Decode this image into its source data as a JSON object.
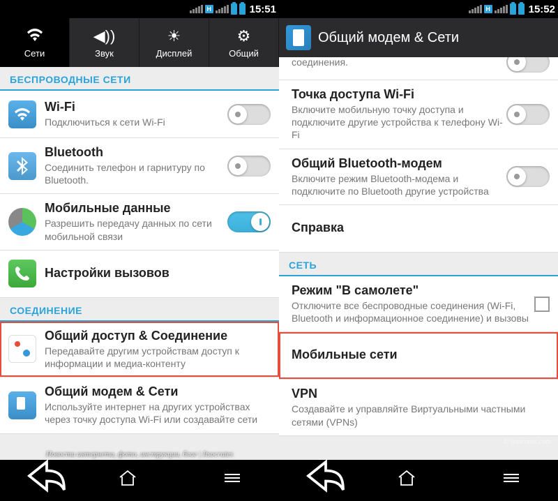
{
  "left": {
    "time": "15:51",
    "tabs": {
      "networks": "Сети",
      "sound": "Звук",
      "display": "Дисплей",
      "general": "Общий"
    },
    "sections": {
      "wireless": "БЕСПРОВОДНЫЕ СЕТИ",
      "connection": "СОЕДИНЕНИЕ"
    },
    "wifi": {
      "title": "Wi-Fi",
      "sub": "Подключиться к сети Wi-Fi"
    },
    "bluetooth": {
      "title": "Bluetooth",
      "sub": "Соединить телефон и гарнитуру по Bluetooth."
    },
    "mobiledata": {
      "title": "Мобильные данные",
      "sub": "Разрешить передачу данных по сети мобильной связи"
    },
    "calls": {
      "title": "Настройки вызовов"
    },
    "share": {
      "title": "Общий доступ & Соединение",
      "sub": "Передавайте другим устройствам доступ к информации и медиа-контенту"
    },
    "tether": {
      "title": "Общий модем & Сети",
      "sub": "Используйте интернет на других устройствах через точку доступа Wi-Fi или создавайте сети"
    }
  },
  "right": {
    "time": "15:52",
    "header": "Общий модем & Сети",
    "cut_sub": "соединения.",
    "hotspot": {
      "title": "Точка доступа Wi-Fi",
      "sub": "Включите мобильную точку доступа и подключите другие устройства к телефону Wi-Fi"
    },
    "btmodem": {
      "title": "Общий Bluetooth-модем",
      "sub": "Включите режим Bluetooth-модема и подключите по Bluetooth другие устройства"
    },
    "help": {
      "title": "Справка"
    },
    "section_net": "СЕТЬ",
    "airplane": {
      "title": "Режим \"В самолете\"",
      "sub": "Отключите все беспроводные соединения (Wi-Fi, Bluetooth и информационное соединение) и вызовы"
    },
    "mobilenet": {
      "title": "Мобильные сети"
    },
    "vpn": {
      "title": "VPN",
      "sub": "Создавайте и управляйте Виртуальными частными сетями (VPNs)"
    }
  },
  "watermark": "Новости интернета, фото, инструкции, блог | Itsocrates",
  "wm_right": "© itsocrates.com"
}
